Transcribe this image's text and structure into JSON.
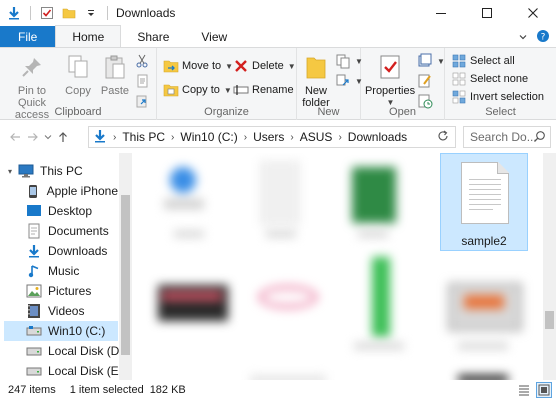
{
  "window": {
    "title": "Downloads"
  },
  "ribbon_tabs": [
    "File",
    "Home",
    "Share",
    "View"
  ],
  "ribbon": {
    "clipboard": {
      "label": "Clipboard",
      "pin": "Pin to Quick access",
      "copy": "Copy",
      "paste": "Paste"
    },
    "organize": {
      "label": "Organize",
      "move_to": "Move to",
      "copy_to": "Copy to",
      "delete": "Delete",
      "rename": "Rename"
    },
    "new": {
      "label": "New",
      "new_folder": "New folder"
    },
    "open": {
      "label": "Open",
      "properties": "Properties"
    },
    "select": {
      "label": "Select",
      "select_all": "Select all",
      "select_none": "Select none",
      "invert": "Invert selection"
    }
  },
  "address": {
    "crumbs": [
      "This PC",
      "Win10 (C:)",
      "Users",
      "ASUS",
      "Downloads"
    ]
  },
  "search": {
    "placeholder": "Search Do..."
  },
  "sidebar": {
    "items": [
      {
        "label": "This PC",
        "icon": "pc-icon"
      },
      {
        "label": "Apple iPhone",
        "icon": "phone-icon"
      },
      {
        "label": "Desktop",
        "icon": "desktop-icon"
      },
      {
        "label": "Documents",
        "icon": "documents-icon"
      },
      {
        "label": "Downloads",
        "icon": "download-icon"
      },
      {
        "label": "Music",
        "icon": "music-icon"
      },
      {
        "label": "Pictures",
        "icon": "pictures-icon"
      },
      {
        "label": "Videos",
        "icon": "videos-icon"
      },
      {
        "label": "Win10 (C:)",
        "icon": "drive-icon",
        "selected": true
      },
      {
        "label": "Local Disk (D:)",
        "icon": "drive-icon"
      },
      {
        "label": "Local Disk (E:)",
        "icon": "drive-icon"
      }
    ]
  },
  "files": {
    "selected_name": "sample2"
  },
  "status": {
    "item_count": "247 items",
    "selection": "1 item selected",
    "size": "182 KB"
  },
  "colors": {
    "accent": "#1979ca",
    "selection": "#cce8ff",
    "selection_border": "#99d1ff"
  }
}
